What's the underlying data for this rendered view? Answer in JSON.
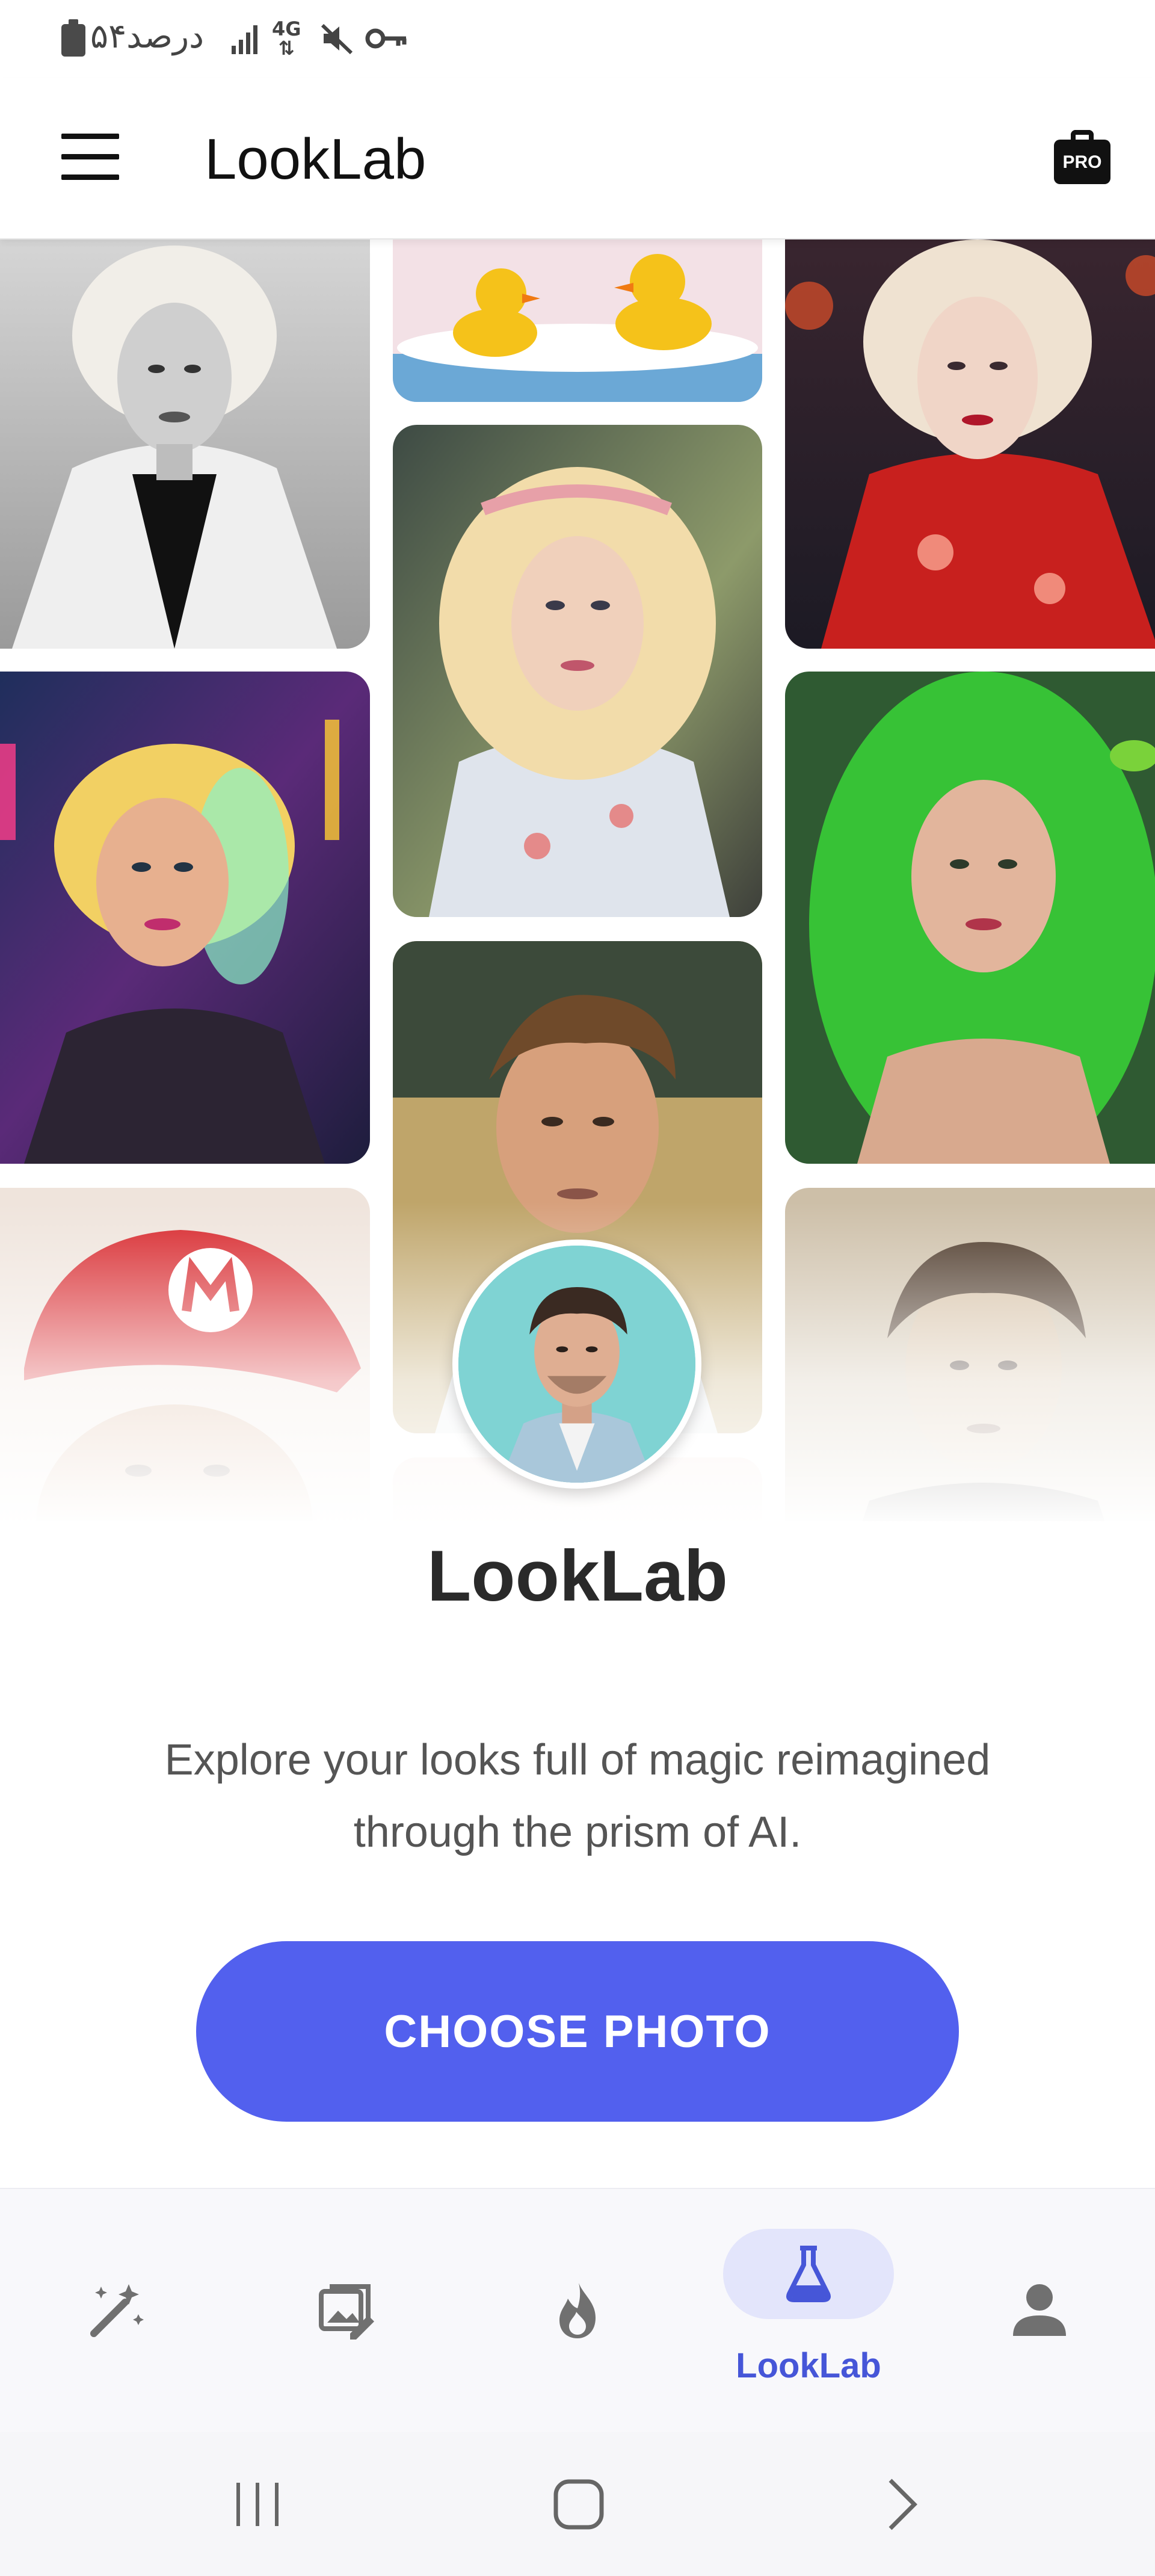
{
  "status_bar": {
    "battery_text": "۵۴درصد",
    "network": "4G",
    "icons": [
      "battery-icon",
      "signal-icon",
      "network-4g-icon",
      "mute-icon",
      "vpn-key-icon"
    ]
  },
  "app_bar": {
    "title": "LookLab",
    "pro_badge": "PRO",
    "icons": [
      "menu-icon",
      "pro-briefcase-icon"
    ]
  },
  "hero": {
    "brand_name": "LookLab",
    "tagline": "Explore your looks full of magic reimagined through the prism of AI.",
    "cta_label": "CHOOSE PHOTO"
  },
  "bottom_nav": {
    "items": [
      {
        "icon": "magic-wand-icon",
        "label": "",
        "active": false
      },
      {
        "icon": "photo-edit-icon",
        "label": "",
        "active": false
      },
      {
        "icon": "flame-icon",
        "label": "",
        "active": false
      },
      {
        "icon": "flask-icon",
        "label": "LookLab",
        "active": true
      },
      {
        "icon": "person-icon",
        "label": "",
        "active": false
      }
    ]
  },
  "system_nav": {
    "icons": [
      "recents-icon",
      "home-icon",
      "back-icon"
    ]
  },
  "colors": {
    "accent": "#5260ee",
    "accent_dark": "#4656d8",
    "active_pill": "#e3e5fb",
    "text_dark": "#2a2a2a",
    "text_muted": "#555555"
  }
}
